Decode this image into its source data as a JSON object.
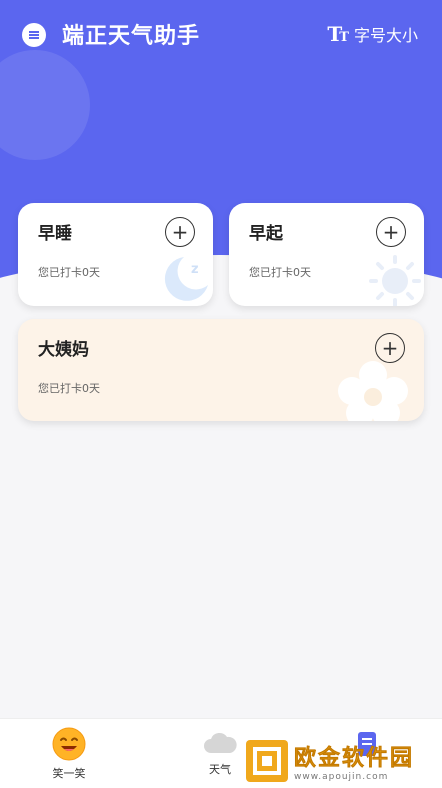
{
  "colors": {
    "brand": "#5b66ef",
    "page": "#f6f6f8",
    "wide_card": "#fdf3e8",
    "accent": "#f0a81c"
  },
  "header": {
    "menu_icon": "menu-icon",
    "title": "端正天气助手",
    "font_icon_big": "T",
    "font_icon_small": "T",
    "font_size_label": "字号大小"
  },
  "cards": [
    {
      "title": "早睡",
      "subtitle": "您已打卡0天",
      "icon": "moon-icon",
      "action_icon": "add-icon"
    },
    {
      "title": "早起",
      "subtitle": "您已打卡0天",
      "icon": "sun-icon",
      "action_icon": "add-icon"
    },
    {
      "title": "大姨妈",
      "subtitle": "您已打卡0天",
      "icon": "flower-icon",
      "action_icon": "add-icon"
    }
  ],
  "tabbar": {
    "tabs": [
      {
        "label": "笑一笑",
        "icon": "smile-icon"
      },
      {
        "label": "天气",
        "icon": "cloud-icon"
      },
      {
        "label": "",
        "icon": "document-icon"
      }
    ]
  },
  "watermark": {
    "text": "欧金软件园",
    "url": "www.apoujin.com"
  }
}
